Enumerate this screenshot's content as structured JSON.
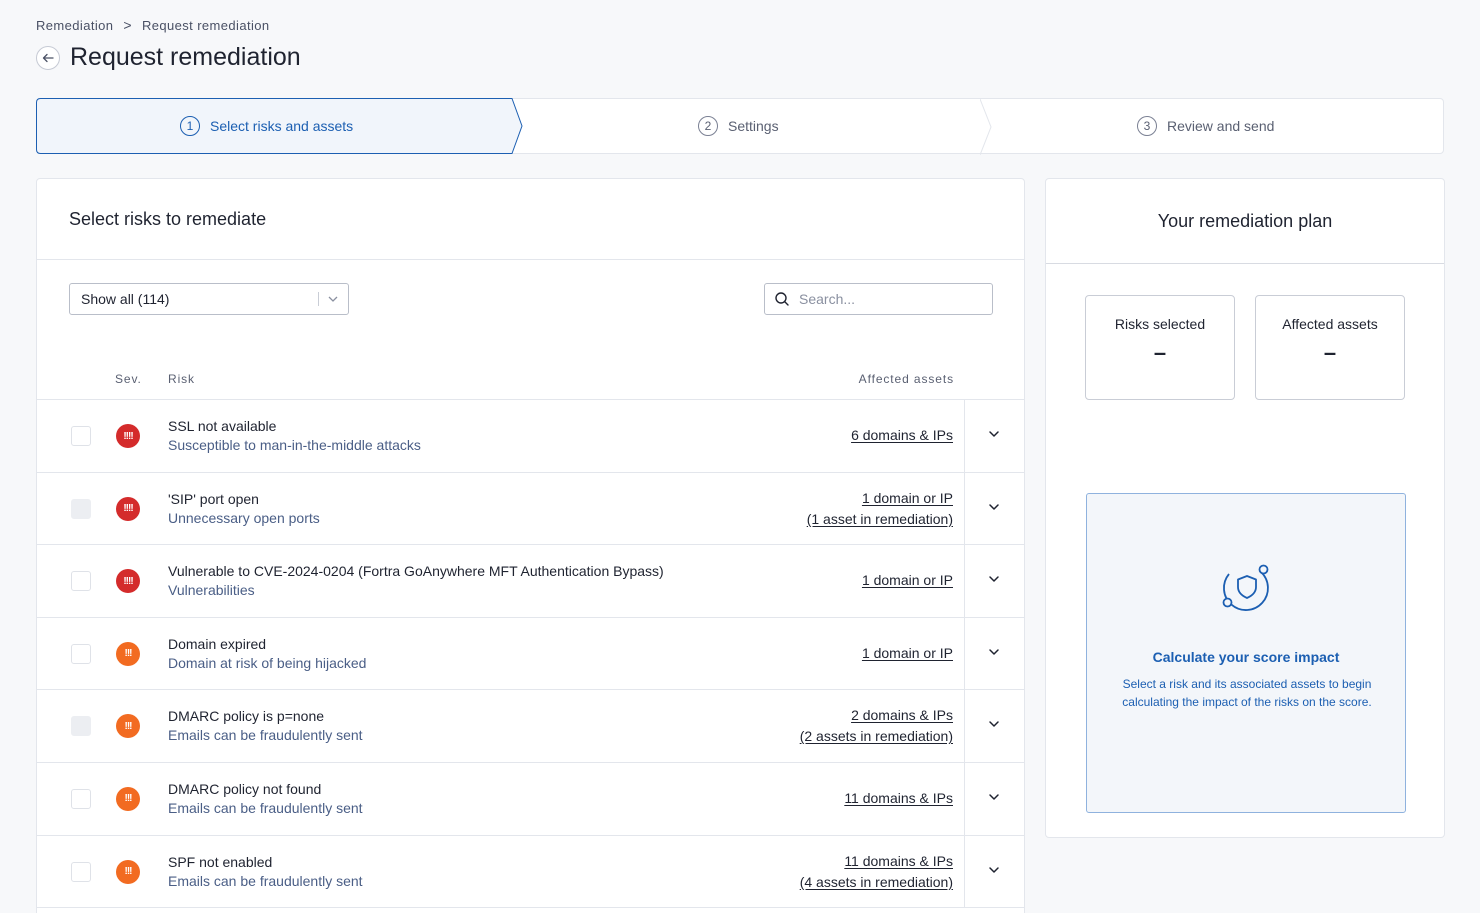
{
  "breadcrumb": {
    "parent": "Remediation",
    "separator": ">",
    "current": "Request remediation"
  },
  "page": {
    "title": "Request remediation"
  },
  "steps": [
    {
      "num": "1",
      "label": "Select risks and assets"
    },
    {
      "num": "2",
      "label": "Settings"
    },
    {
      "num": "3",
      "label": "Review and send"
    }
  ],
  "select_risks": {
    "title": "Select risks to remediate",
    "filter_value": "Show all (114)",
    "search_placeholder": "Search...",
    "columns": {
      "severity": "Sev.",
      "risk": "Risk",
      "assets": "Affected assets"
    },
    "rows": [
      {
        "severity": "critical",
        "icon": "!!!!",
        "name": "SSL not available",
        "category": "Susceptible to man-in-the-middle attacks",
        "assets": "6 domains & IPs",
        "in_remediation": "",
        "disabled": false
      },
      {
        "severity": "critical",
        "icon": "!!!!",
        "name": "'SIP' port open",
        "category": "Unnecessary open ports",
        "assets": "1 domain or IP",
        "in_remediation": "(1 asset in remediation)",
        "disabled": true
      },
      {
        "severity": "critical",
        "icon": "!!!!",
        "name": "Vulnerable to CVE-2024-0204 (Fortra GoAnywhere MFT Authentication Bypass)",
        "category": "Vulnerabilities",
        "assets": "1 domain or IP",
        "in_remediation": "",
        "disabled": false
      },
      {
        "severity": "high",
        "icon": "!!!",
        "name": "Domain expired",
        "category": "Domain at risk of being hijacked",
        "assets": "1 domain or IP",
        "in_remediation": "",
        "disabled": false
      },
      {
        "severity": "high",
        "icon": "!!!",
        "name": "DMARC policy is p=none",
        "category": "Emails can be fraudulently sent",
        "assets": "2 domains & IPs",
        "in_remediation": "(2 assets in remediation)",
        "disabled": true
      },
      {
        "severity": "high",
        "icon": "!!!",
        "name": "DMARC policy not found",
        "category": "Emails can be fraudulently sent",
        "assets": "11 domains & IPs",
        "in_remediation": "",
        "disabled": false
      },
      {
        "severity": "high",
        "icon": "!!!",
        "name": "SPF not enabled",
        "category": "Emails can be fraudulently sent",
        "assets": "11 domains & IPs",
        "in_remediation": "(4 assets in remediation)",
        "disabled": false
      }
    ]
  },
  "plan": {
    "title": "Your remediation plan",
    "risks_selected_label": "Risks selected",
    "risks_selected_value": "–",
    "affected_assets_label": "Affected assets",
    "affected_assets_value": "–",
    "impact_title": "Calculate your score impact",
    "impact_desc": "Select a risk and its associated assets to begin calculating the impact of the risks on the score."
  },
  "colors": {
    "critical": "#d42b2b",
    "high": "#f26b21",
    "accent": "#1c5fb2"
  }
}
